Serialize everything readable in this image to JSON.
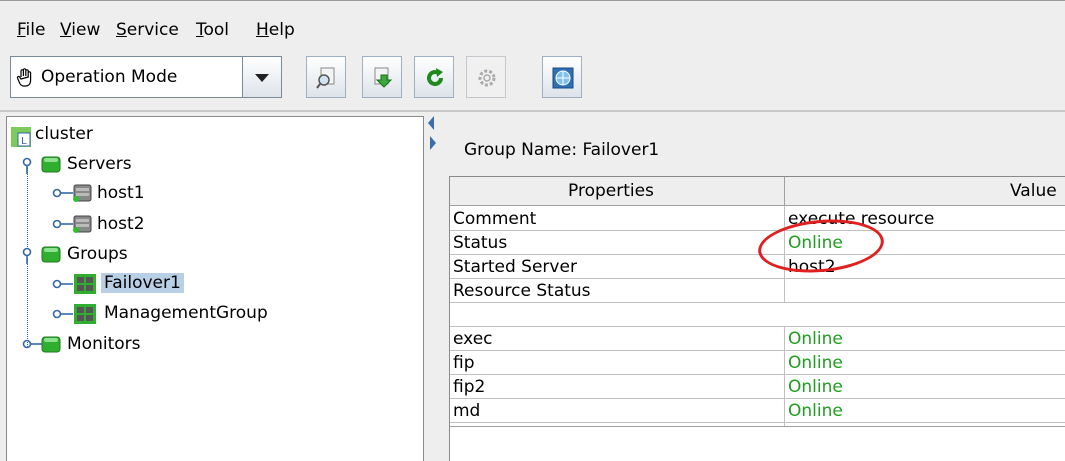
{
  "menu": [
    "File",
    "View",
    "Service",
    "Tool",
    "Help"
  ],
  "menu_mnemonic": [
    "F",
    "V",
    "S",
    "T",
    "H"
  ],
  "menu_rest": [
    "ile",
    "iew",
    "ervice",
    "ool",
    "elp"
  ],
  "toolbar": {
    "mode_label": "Operation Mode",
    "buttons": [
      "magnifier-icon",
      "download-green-icon",
      "refresh-green-icon",
      "gear-icon",
      "globe-icon"
    ]
  },
  "tree": {
    "root": "cluster",
    "servers": "Servers",
    "host1": "host1",
    "host2": "host2",
    "groups": "Groups",
    "failover1": "Failover1",
    "management_group": "ManagementGroup",
    "monitors": "Monitors"
  },
  "detail": {
    "group_name": "Group Name: Failover1",
    "col_properties": "Properties",
    "col_value": "Value",
    "rows": [
      {
        "prop": "Comment",
        "value": "execute resource",
        "green": false
      },
      {
        "prop": "Status",
        "value": "Online",
        "green": true
      },
      {
        "prop": "Started Server",
        "value": "host2",
        "green": false
      },
      {
        "prop": "Resource Status",
        "value": "",
        "green": false
      },
      {
        "prop": "exec",
        "value": "Online",
        "green": true
      },
      {
        "prop": "fip",
        "value": "Online",
        "green": true
      },
      {
        "prop": "fip2",
        "value": "Online",
        "green": true
      },
      {
        "prop": "md",
        "value": "Online",
        "green": true
      }
    ]
  },
  "colors": {
    "online": "#1f9d1f",
    "highlight_circle": "#e02020",
    "selection": "#b8cfe5"
  }
}
